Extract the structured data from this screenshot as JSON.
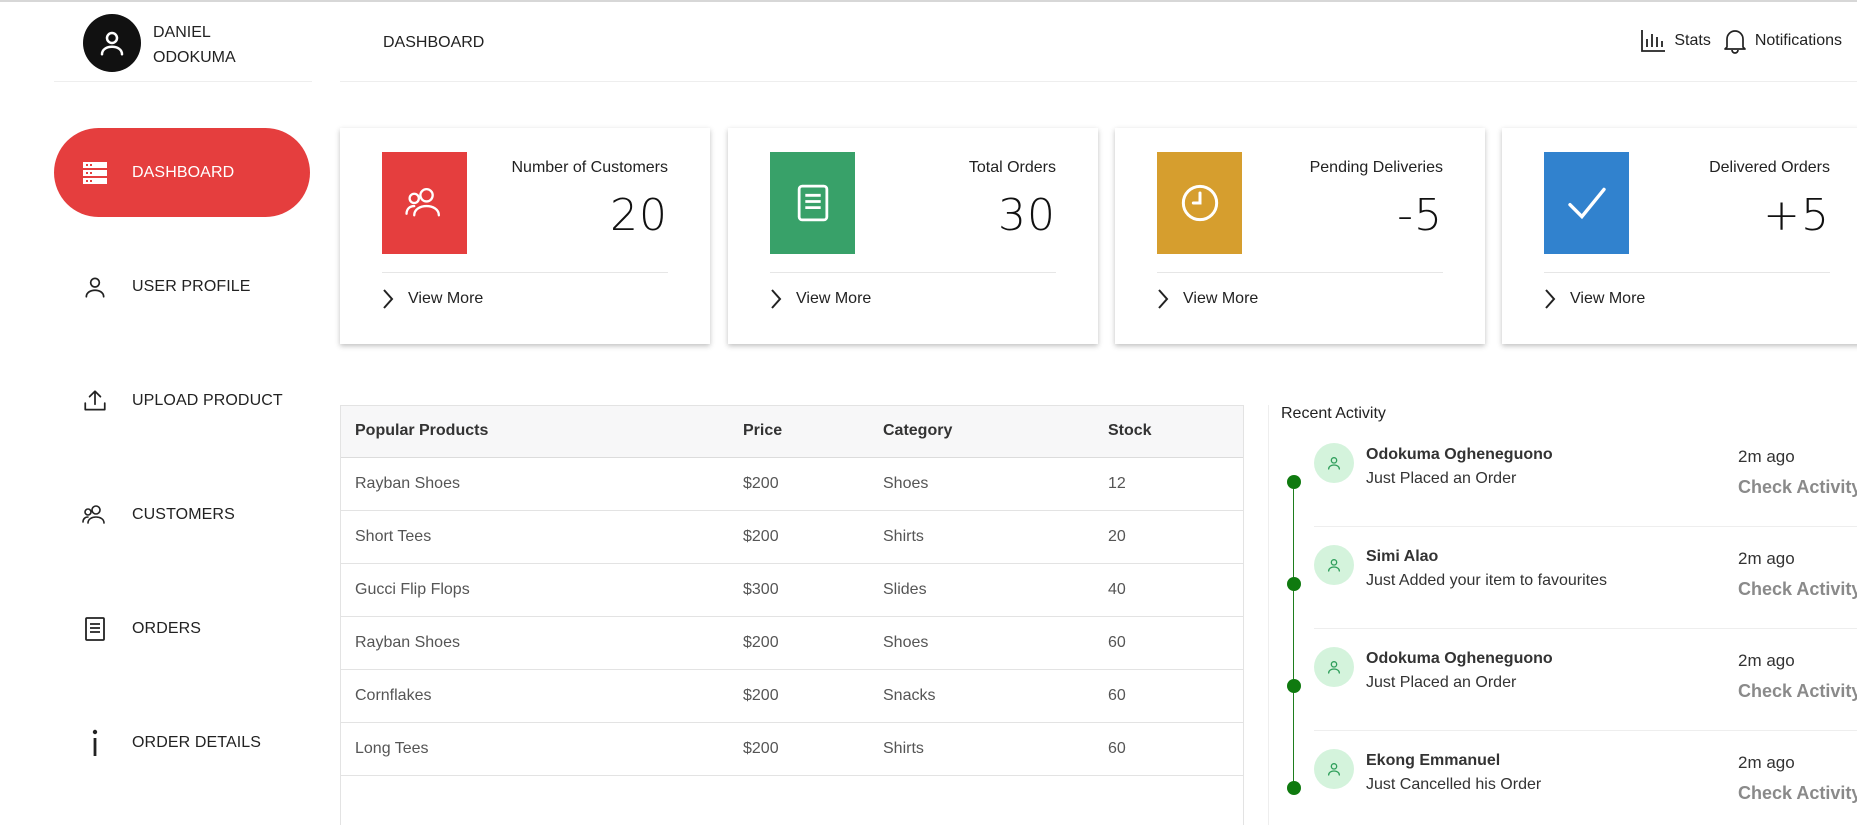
{
  "user": {
    "first_name": "DANIEL",
    "last_name": "ODOKUMA",
    "avatar_icon": "user-icon"
  },
  "sidebar": {
    "items": [
      {
        "label": "DASHBOARD",
        "icon": "server-list-icon",
        "active": true
      },
      {
        "label": "USER PROFILE",
        "icon": "user-icon",
        "active": false
      },
      {
        "label": "UPLOAD PRODUCT",
        "icon": "upload-icon",
        "active": false
      },
      {
        "label": "CUSTOMERS",
        "icon": "users-icon",
        "active": false
      },
      {
        "label": "ORDERS",
        "icon": "document-icon",
        "active": false
      },
      {
        "label": "ORDER DETAILS",
        "icon": "info-icon",
        "active": false
      }
    ]
  },
  "header": {
    "title": "DASHBOARD",
    "stats_label": "Stats",
    "notifications_label": "Notifications"
  },
  "cards": [
    {
      "label": "Number of Customers",
      "value": "20",
      "link": "View More",
      "color": "#e53e3e",
      "icon": "users-icon"
    },
    {
      "label": "Total Orders",
      "value": "30",
      "link": "View More",
      "color": "#38a169",
      "icon": "book-icon"
    },
    {
      "label": "Pending Deliveries",
      "value": "-5",
      "link": "View More",
      "color": "#d69e2e",
      "icon": "clock-icon"
    },
    {
      "label": "Delivered Orders",
      "value": "+5",
      "link": "View More",
      "color": "#3182ce",
      "icon": "check-icon"
    }
  ],
  "products": {
    "columns": [
      "Popular Products",
      "Price",
      "Category",
      "Stock"
    ],
    "rows": [
      [
        "Rayban Shoes",
        "$200",
        "Shoes",
        "12"
      ],
      [
        "Short Tees",
        "$200",
        "Shirts",
        "20"
      ],
      [
        "Gucci Flip Flops",
        "$300",
        "Slides",
        "40"
      ],
      [
        "Rayban Shoes",
        "$200",
        "Shoes",
        "60"
      ],
      [
        "Cornflakes",
        "$200",
        "Snacks",
        "60"
      ],
      [
        "Long Tees",
        "$200",
        "Shirts",
        "60"
      ]
    ]
  },
  "activity": {
    "title": "Recent Activity",
    "items": [
      {
        "name": "Odokuma Ogheneguono",
        "desc": "Just Placed an Order",
        "time": "2m ago",
        "action": "Check Activity"
      },
      {
        "name": "Simi Alao",
        "desc": "Just Added your item to favourites",
        "time": "2m ago",
        "action": "Check Activity"
      },
      {
        "name": "Odokuma Ogheneguono",
        "desc": "Just Placed an Order",
        "time": "2m ago",
        "action": "Check Activity"
      },
      {
        "name": "Ekong Emmanuel",
        "desc": "Just Cancelled his Order",
        "time": "2m ago",
        "action": "Check Activity"
      }
    ]
  }
}
